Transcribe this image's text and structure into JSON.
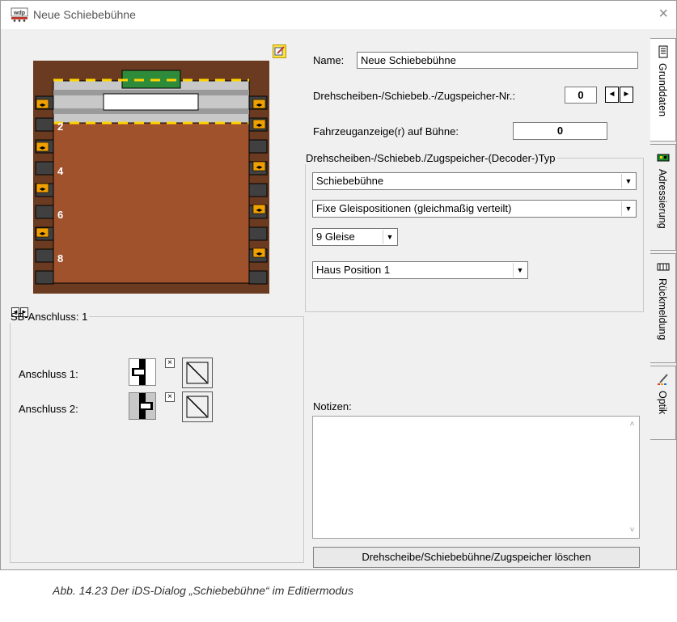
{
  "window": {
    "title": "Neue Schiebebühne",
    "app_icon": "wdp-app-icon",
    "close_label": "×"
  },
  "preview": {
    "track_labels": [
      "2",
      "4",
      "6",
      "8"
    ],
    "colors": {
      "frame": "#6b3b21",
      "pit": "#a0522d",
      "bridge": "#c8c8c8",
      "bridge_house": "#2e8b3a",
      "dashes": "#ffd400",
      "connector": "#f0a000"
    },
    "edit_icon": "edit-icon",
    "scroll_left": "◄",
    "scroll_right": "►"
  },
  "sb_connection": {
    "legend": "SB-Anschluss: 1",
    "rows": [
      {
        "label": "Anschluss 1:",
        "x_label": "×"
      },
      {
        "label": "Anschluss 2:",
        "x_label": "×"
      }
    ]
  },
  "form": {
    "name_label": "Name:",
    "name_value": "Neue Schiebebühne",
    "number_label": "Drehscheiben-/Schiebeb.-/Zugspeicher-Nr.:",
    "number_value": "0",
    "spin_left": "◄",
    "spin_right": "►",
    "vehicle_label": "Fahrzeuganzeige(r) auf Bühne:",
    "vehicle_value": "0"
  },
  "type_group": {
    "legend": "Drehscheiben-/Schiebeb./Zugspeicher-(Decoder-)Typ",
    "type_select": "Schiebebühne",
    "positions_select": "Fixe Gleispositionen (gleichmaßig verteilt)",
    "tracks_select": "9 Gleise",
    "home_select": "Haus Position 1",
    "dropdown_arrow": "▼"
  },
  "notes": {
    "label": "Notizen:",
    "value": "",
    "scroll_up": "˄",
    "scroll_down": "˅"
  },
  "delete_button": "Drehscheibe/Schiebebühne/Zugspeicher löschen",
  "tabs": [
    {
      "label": "Grunddaten",
      "icon": "document-icon"
    },
    {
      "label": "Adressierung",
      "icon": "decoder-icon"
    },
    {
      "label": "Rückmeldung",
      "icon": "feedback-icon"
    },
    {
      "label": "Optik",
      "icon": "paint-icon"
    }
  ],
  "caption": "Abb. 14.23  Der iDS-Dialog „Schiebebühne“ im Editiermodus"
}
